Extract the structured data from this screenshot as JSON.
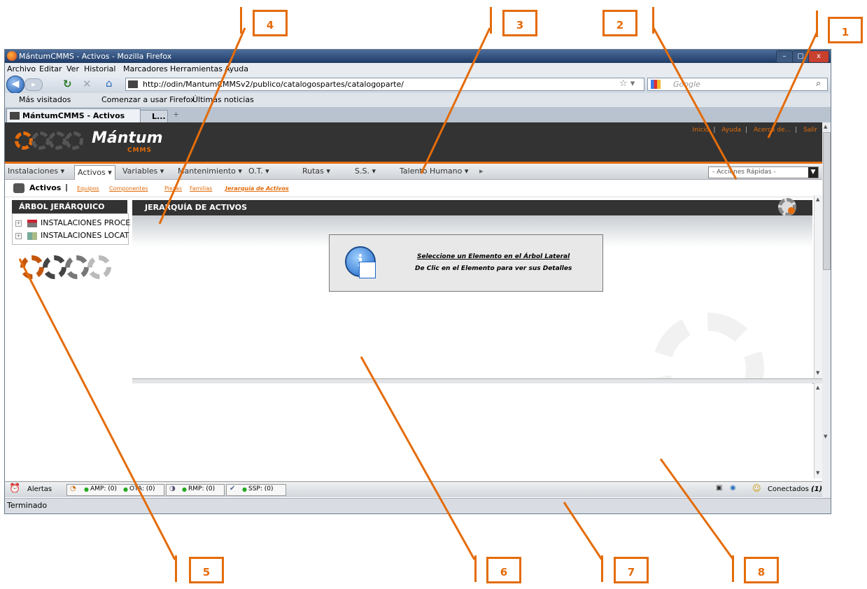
{
  "window": {
    "title": "MántumCMMS - Activos - Mozilla Firefox",
    "controls": [
      "–",
      "▢",
      "x"
    ]
  },
  "menubar": [
    "Archivo",
    "Editar",
    "Ver",
    "Historial",
    "Marcadores",
    "Herramientas",
    "Ayuda"
  ],
  "navigation": {
    "url": "http://odin/MantumCMMSv2/publico/catalogospartes/catalogoparte/",
    "search_placeholder": "Google"
  },
  "bookmarks": [
    "Más visitados",
    "Comenzar a usar Firefox",
    "Últimas noticias"
  ],
  "tabs": [
    {
      "label": "MántumCMMS - Activos",
      "active": true
    },
    {
      "label": "L...",
      "active": false
    }
  ],
  "app": {
    "logo_text": "Mántum",
    "logo_sub": "CMMS",
    "top_links": [
      "Inicio",
      "Ayuda",
      "Acerca de...",
      "Salir"
    ],
    "nav_items": [
      "Instalaciones ▾",
      "Activos ▾",
      "Variables ▾",
      "Mantenimiento ▾",
      "O.T. ▾",
      "Rutas ▾",
      "S.S. ▾",
      "Talento Humano ▾"
    ],
    "nav_selected": "Activos ▾",
    "quick_actions": "- Acciones Rápidas -",
    "section_title": "Activos",
    "sub_links": [
      "Equipos",
      "Componentes",
      "Piezas",
      "Familias",
      "Jerarquía de Activos"
    ],
    "tree_title": "ÁRBOL JERÁRQUICO",
    "tree_items": [
      "INSTALACIONES PROCE",
      "INSTALACIONES LOCAT"
    ],
    "main_title": "JERARQUÍA DE ACTIVOS",
    "info_line1": "Seleccione un Elemento en el Árbol Lateral",
    "info_line2": "De Clic en el Elemento para ver sus Detalles",
    "status": {
      "alerts": "Alertas",
      "amp": "AMP: (0)",
      "ota": "OTA: (0)",
      "rmp": "RMP: (0)",
      "ssp": "SSP: (0)",
      "connected_label": "Conectados",
      "connected_count": "(1)"
    }
  },
  "browser_status": "Terminado",
  "callouts": [
    "1",
    "2",
    "3",
    "4",
    "5",
    "6",
    "7",
    "8"
  ],
  "colors": {
    "accent": "#e46c0a",
    "header": "#333333"
  }
}
